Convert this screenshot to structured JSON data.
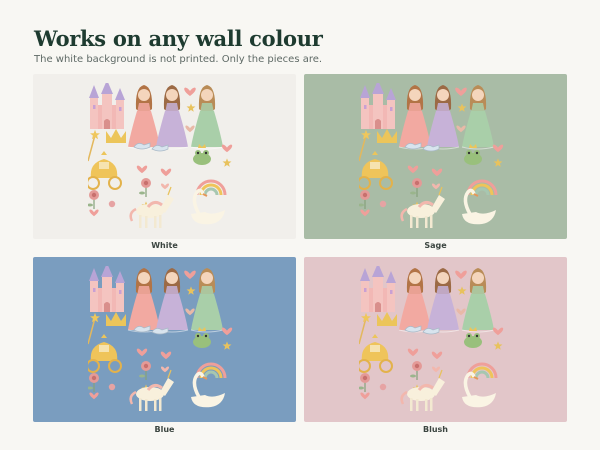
{
  "header": {
    "title": "Works on any wall colour",
    "subtitle": "The white background is not printed. Only the pieces are."
  },
  "swatches": [
    {
      "label": "White",
      "color": "#f1efeb"
    },
    {
      "label": "Sage",
      "color": "#a9bca6"
    },
    {
      "label": "Blue",
      "color": "#7a9dbf"
    },
    {
      "label": "Blush",
      "color": "#e2c6c9"
    }
  ],
  "icons": [
    "castle-icon",
    "princess-icon",
    "heart-icon",
    "star-icon",
    "crown-icon",
    "glass-slipper-icon",
    "frog-icon",
    "wand-icon",
    "carriage-icon",
    "flower-icon",
    "rainbow-icon",
    "unicorn-icon",
    "swan-icon"
  ]
}
